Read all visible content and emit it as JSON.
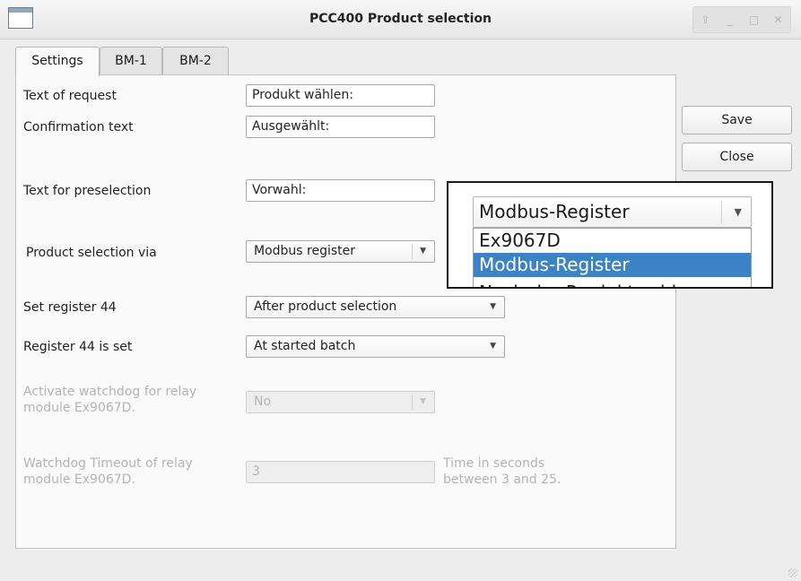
{
  "window": {
    "title": "PCC400 Product selection",
    "controls": {
      "up": "⇧",
      "minimize": "_",
      "maximize": "□",
      "close": "✕"
    }
  },
  "tabs": [
    {
      "label": "Settings",
      "active": true
    },
    {
      "label": "BM-1",
      "active": false
    },
    {
      "label": "BM-2",
      "active": false
    }
  ],
  "form": {
    "text_of_request": {
      "label": "Text of request",
      "value": "Produkt wählen:"
    },
    "confirmation_text": {
      "label": "Confirmation text",
      "value": "Ausgewählt:"
    },
    "text_for_preselection": {
      "label": "Text for preselection",
      "value": "Vorwahl:"
    },
    "product_selection_via": {
      "label": "Product selection via",
      "value": "Modbus register"
    },
    "set_register_44": {
      "label": "Set register 44",
      "value": "After product selection"
    },
    "register_44_is_set": {
      "label": "Register 44 is set",
      "value": "At started batch"
    },
    "activate_watchdog": {
      "label_line1": "Activate watchdog for relay",
      "label_line2": "module Ex9067D.",
      "value": "No",
      "disabled": true
    },
    "watchdog_timeout": {
      "label_line1": "Watchdog Timeout of relay",
      "label_line2": "module Ex9067D.",
      "value": "3",
      "hint_line1": "Time in seconds",
      "hint_line2": "between 3 and 25.",
      "disabled": true
    }
  },
  "buttons": {
    "save": "Save",
    "close": "Close"
  },
  "popup": {
    "combo_value": "Modbus-Register",
    "options": [
      {
        "label": "Ex9067D",
        "selected": false
      },
      {
        "label": "Modbus-Register",
        "selected": true
      },
      {
        "label": "Nach der Produktwahl",
        "selected": false
      }
    ]
  },
  "colors": {
    "selection_highlight": "#3c83c6",
    "disabled_text": "#b4b4b4"
  },
  "icons": {
    "dropdown_arrow": "▼"
  }
}
